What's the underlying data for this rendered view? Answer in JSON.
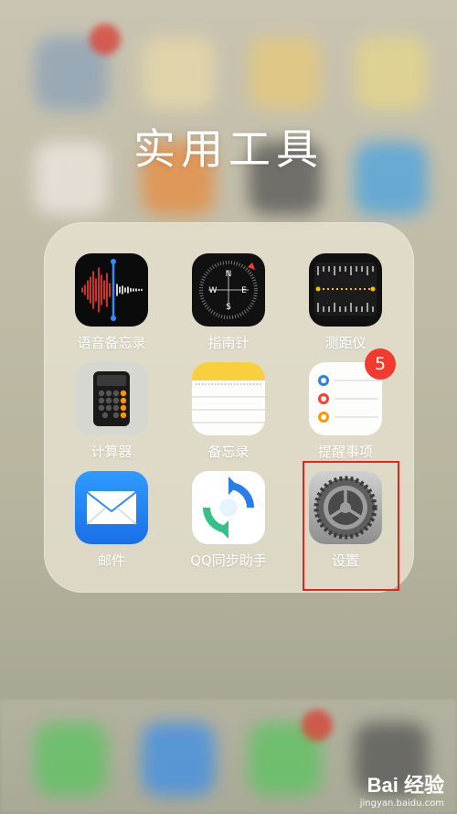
{
  "folder": {
    "title": "实用工具"
  },
  "apps": [
    {
      "name": "语音备忘录",
      "icon": "voice-memos-icon"
    },
    {
      "name": "指南针",
      "icon": "compass-icon",
      "compass_letters": [
        "N",
        "E",
        "S",
        "W"
      ]
    },
    {
      "name": "测距仪",
      "icon": "measure-icon"
    },
    {
      "name": "计算器",
      "icon": "calculator-icon"
    },
    {
      "name": "备忘录",
      "icon": "notes-icon"
    },
    {
      "name": "提醒事项",
      "icon": "reminders-icon",
      "badge": "5"
    },
    {
      "name": "邮件",
      "icon": "mail-icon"
    },
    {
      "name": "QQ同步助手",
      "icon": "qq-sync-icon"
    },
    {
      "name": "设置",
      "icon": "settings-gear-icon"
    }
  ],
  "colors": {
    "badge": "#f23a2f",
    "highlight_box": "#e3231c",
    "voice_wave": "#ff3b30"
  },
  "watermark": {
    "brand": "Bai 经验",
    "site": "jingyan.baidu.com"
  }
}
